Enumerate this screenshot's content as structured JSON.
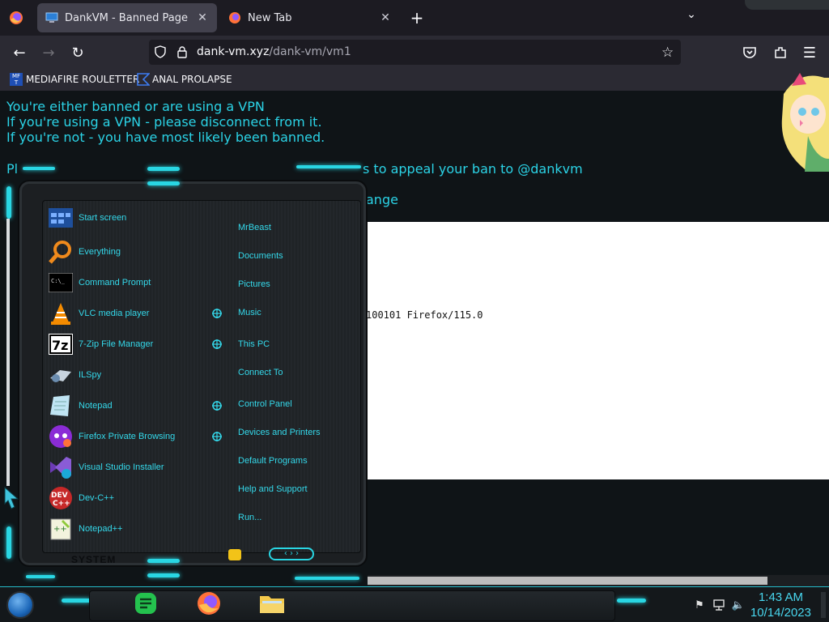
{
  "browser": {
    "tabs": [
      {
        "title": "DankVM - Banned Page",
        "active": true
      },
      {
        "title": "New Tab",
        "active": false
      }
    ],
    "new_tab_glyph": "+",
    "url": {
      "host": "dank-vm.xyz",
      "path": "/dank-vm/vm1"
    },
    "bookmarks": [
      {
        "label": "MEDIAFIRE ROULETTER",
        "icon": "mediafire-icon"
      },
      {
        "label": "ANAL PROLAPSE",
        "icon": "bookmark-frame-icon"
      }
    ]
  },
  "page": {
    "lines": [
      "You're either banned or are using a VPN",
      "If you're using a VPN - please disconnect from it.",
      "If you're not - you have most likely been banned."
    ],
    "appeal_fragment_start": "Pl",
    "appeal_fragment_end": "s to appeal your ban to @dankvm",
    "partial_line_fragment": "ange",
    "user_agent_fragment": "100101 Firefox/115.0",
    "accent_color": "#2bd3e6"
  },
  "start_menu": {
    "programs": [
      {
        "label": "Start screen",
        "icon": "start-screen-icon",
        "has_submenu": false
      },
      {
        "label": "Everything",
        "icon": "magnifier-icon",
        "has_submenu": false
      },
      {
        "label": "Command Prompt",
        "icon": "cmd-icon",
        "has_submenu": false
      },
      {
        "label": "VLC media player",
        "icon": "vlc-cone-icon",
        "has_submenu": true
      },
      {
        "label": "7-Zip File Manager",
        "icon": "seven-zip-icon",
        "has_submenu": true
      },
      {
        "label": "ILSpy",
        "icon": "ilspy-icon",
        "has_submenu": false
      },
      {
        "label": "Notepad",
        "icon": "notepad-icon",
        "has_submenu": true
      },
      {
        "label": "Firefox Private Browsing",
        "icon": "firefox-private-icon",
        "has_submenu": true
      },
      {
        "label": "Visual Studio Installer",
        "icon": "vs-installer-icon",
        "has_submenu": false
      },
      {
        "label": "Dev-C++",
        "icon": "devcpp-icon",
        "has_submenu": false
      },
      {
        "label": "Notepad++",
        "icon": "notepadpp-icon",
        "has_submenu": false
      }
    ],
    "places": [
      "MrBeast",
      "Documents",
      "Pictures",
      "Music",
      "This PC",
      "Connect To",
      "Control Panel",
      "Devices and Printers",
      "Default Programs",
      "Help and Support",
      "Run..."
    ],
    "system_label": "SYSTEM",
    "accent_color": "#29d6e3"
  },
  "taskbar": {
    "apps": [
      {
        "name": "notes-app",
        "icon": "green-notes-icon"
      },
      {
        "name": "firefox",
        "icon": "firefox-icon"
      },
      {
        "name": "file-explorer",
        "icon": "folder-icon"
      }
    ],
    "tray_icons": [
      "flag-icon",
      "network-icon",
      "volume-icon"
    ],
    "time": "1:43 AM",
    "date": "10/14/2023",
    "clock_color": "#48d6ee"
  }
}
